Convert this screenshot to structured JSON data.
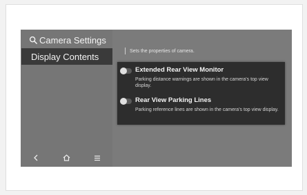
{
  "header": {
    "title": "Camera Settings"
  },
  "sidebar": {
    "items": [
      {
        "label": "Display Contents",
        "selected": true
      }
    ]
  },
  "bottom_nav": [
    {
      "icon": "back-icon",
      "glyph": "<"
    },
    {
      "icon": "home-icon",
      "glyph": "⌂"
    },
    {
      "icon": "menu-icon",
      "glyph": "☰"
    }
  ],
  "main": {
    "description": "Sets the properties of camera.",
    "options": [
      {
        "title": "Extended Rear View Monitor",
        "description": "Parking distance warnings are shown in the camera's top view display.",
        "enabled": false
      },
      {
        "title": "Rear View Parking Lines",
        "description": "Parking reference lines are shown in the camera's top view display.",
        "enabled": false
      }
    ]
  },
  "colors": {
    "screen_bg": "#7b7b7b",
    "selected_item_bg": "#3a3a3a",
    "panel_bg": "#2d2d2d",
    "text": "#f4f4f4"
  }
}
